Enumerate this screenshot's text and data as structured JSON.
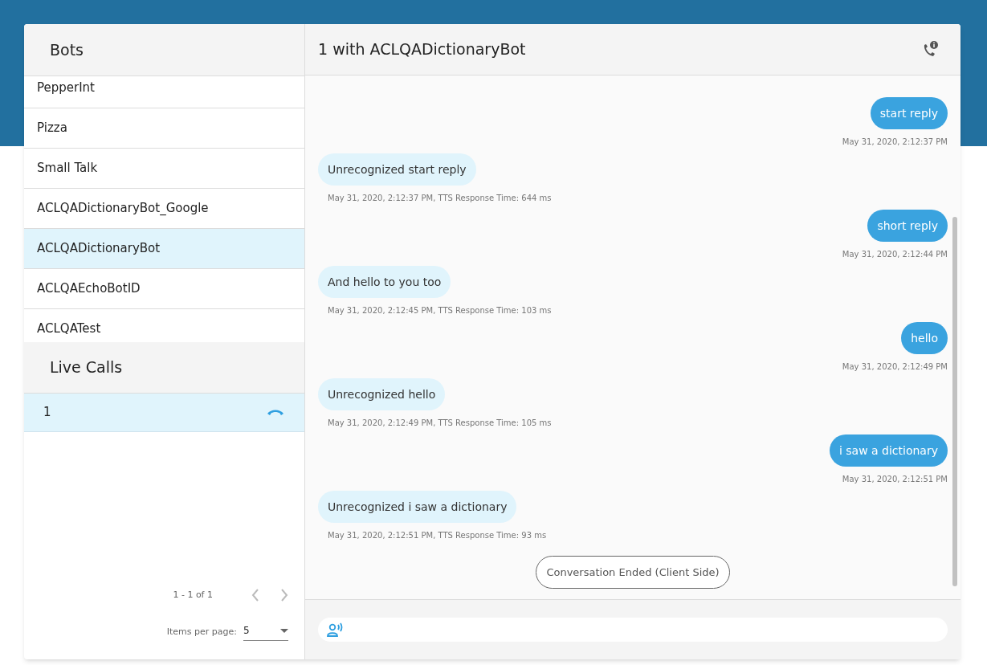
{
  "bots": {
    "title": "Bots",
    "items": [
      {
        "label": "PepperInt",
        "selected": false
      },
      {
        "label": "Pizza",
        "selected": false
      },
      {
        "label": "Small Talk",
        "selected": false
      },
      {
        "label": "ACLQADictionaryBot_Google",
        "selected": false
      },
      {
        "label": "ACLQADictionaryBot",
        "selected": true
      },
      {
        "label": "ACLQAEchoBotID",
        "selected": false
      },
      {
        "label": "ACLQATest",
        "selected": false
      }
    ]
  },
  "live_calls": {
    "title": "Live Calls",
    "items": [
      {
        "label": "1",
        "selected": true
      }
    ],
    "range": "1 - 1 of 1",
    "items_per_page_label": "Items per page:",
    "items_per_page": "5"
  },
  "chat": {
    "title": "1 with ACLQADictionaryBot",
    "messages": [
      {
        "kind": "user",
        "text": "start reply",
        "meta": "May 31, 2020, 2:12:37 PM"
      },
      {
        "kind": "bot",
        "text": "Unrecognized start reply",
        "meta": "May 31, 2020, 2:12:37 PM, TTS Response Time: 644 ms"
      },
      {
        "kind": "user",
        "text": "short reply",
        "meta": "May 31, 2020, 2:12:44 PM"
      },
      {
        "kind": "bot",
        "text": "And hello to you too",
        "meta": "May 31, 2020, 2:12:45 PM, TTS Response Time: 103 ms"
      },
      {
        "kind": "user",
        "text": "hello",
        "meta": "May 31, 2020, 2:12:49 PM"
      },
      {
        "kind": "bot",
        "text": "Unrecognized hello",
        "meta": "May 31, 2020, 2:12:49 PM, TTS Response Time: 105 ms"
      },
      {
        "kind": "user",
        "text": "i saw a dictionary",
        "meta": "May 31, 2020, 2:12:51 PM"
      },
      {
        "kind": "bot",
        "text": "Unrecognized i saw a dictionary",
        "meta": "May 31, 2020, 2:12:51 PM, TTS Response Time: 93 ms"
      }
    ],
    "status": "Conversation Ended (Client Side)"
  }
}
